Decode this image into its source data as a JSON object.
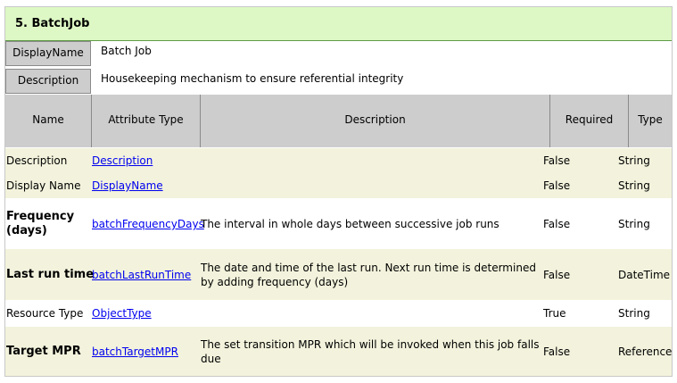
{
  "section_title": "5. BatchJob",
  "meta": {
    "display_name_label": "DisplayName",
    "display_name_value": "Batch Job",
    "description_label": "Description",
    "description_value": "Housekeeping mechanism to ensure referential integrity"
  },
  "columns": {
    "name": "Name",
    "attribute_type": "Attribute Type",
    "description": "Description",
    "required": "Required",
    "type": "Type"
  },
  "rows": [
    {
      "name": "Description",
      "attribute": "Description",
      "description": "",
      "required": "False",
      "type": "String"
    },
    {
      "name": "Display Name",
      "attribute": "DisplayName",
      "description": "",
      "required": "False",
      "type": "String"
    },
    {
      "name_line1": "Frequency",
      "name_line2": "(days)",
      "attribute": "batchFrequencyDays",
      "description": "The interval in whole days between successive job runs",
      "required": "False",
      "type": "String"
    },
    {
      "name": "Last run time",
      "attribute": "batchLastRunTime",
      "description_line1": "The date and time of the last run. Next run time is determined",
      "description_line2": "by adding frequency (days)",
      "required": "False",
      "type": "DateTime"
    },
    {
      "name": "Resource Type",
      "attribute": "ObjectType",
      "description": "",
      "required": "True",
      "type": "String"
    },
    {
      "name": "Target MPR",
      "attribute": "batchTargetMPR",
      "description_line1": "The set transition MPR which will be invoked when this job falls",
      "description_line2": "due",
      "required": "False",
      "type": "Reference"
    }
  ]
}
